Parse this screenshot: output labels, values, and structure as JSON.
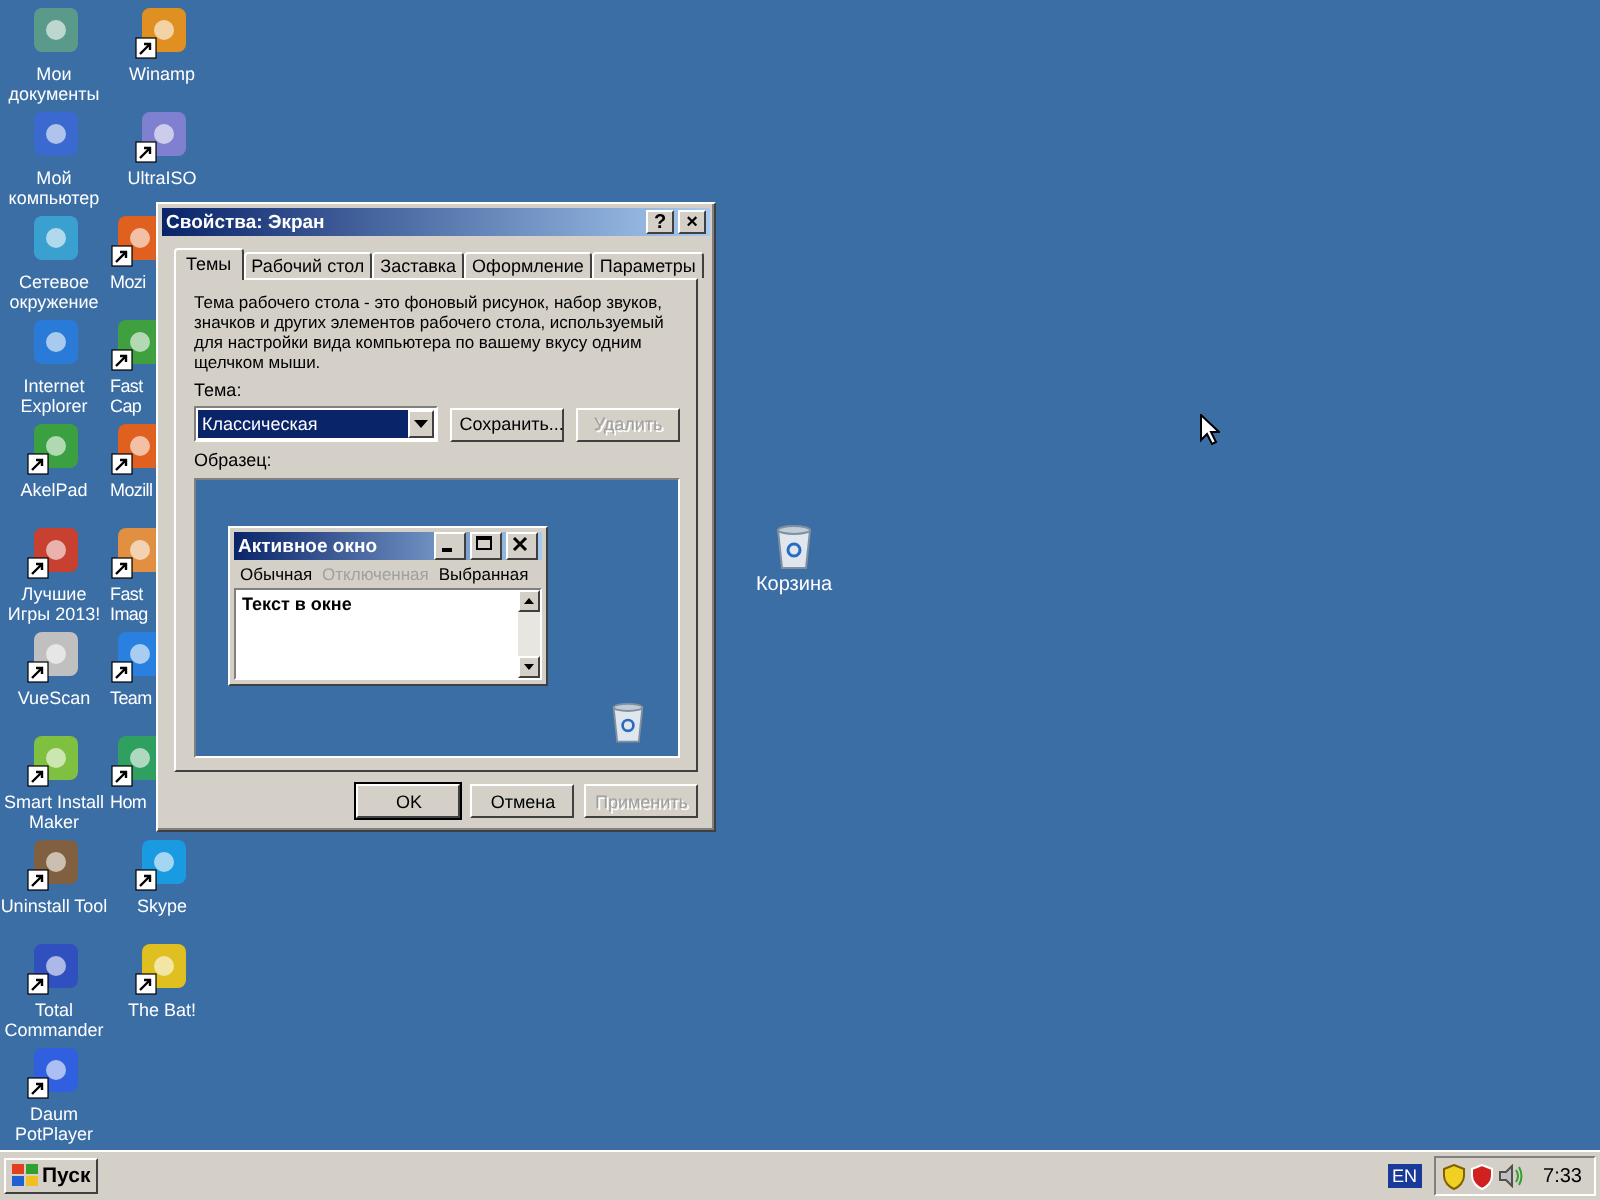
{
  "desktop_icons": [
    {
      "label": "Мои документы",
      "color": "#5a9a8a",
      "shortcut": false,
      "partial": false
    },
    {
      "label": "Мой компьютер",
      "color": "#3a6ad0",
      "shortcut": false,
      "partial": false
    },
    {
      "label": "Сетевое окружение",
      "color": "#3aa0d0",
      "shortcut": false,
      "partial": false
    },
    {
      "label": "Internet Explorer",
      "color": "#2a7ad8",
      "shortcut": false,
      "partial": false
    },
    {
      "label": "AkelPad",
      "color": "#3aa040",
      "shortcut": true,
      "partial": false
    },
    {
      "label": "Лучшие Игры 2013!",
      "color": "#c84030",
      "shortcut": true,
      "partial": false
    },
    {
      "label": "VueScan",
      "color": "#c0c0c0",
      "shortcut": true,
      "partial": false
    },
    {
      "label": "Smart Install Maker",
      "color": "#80c040",
      "shortcut": true,
      "partial": false
    },
    {
      "label": "Uninstall Tool",
      "color": "#806040",
      "shortcut": true,
      "partial": false
    },
    {
      "label": "Total Commander",
      "color": "#3050c0",
      "shortcut": true,
      "partial": false
    },
    {
      "label": "Daum PotPlayer",
      "color": "#3060e0",
      "shortcut": true,
      "partial": false
    },
    {
      "label": "Winamp",
      "color": "#e09020",
      "shortcut": true,
      "partial": false
    },
    {
      "label": "UltraISO",
      "color": "#8080d0",
      "shortcut": true,
      "partial": false
    },
    {
      "label": "Mozi",
      "color": "#e06020",
      "shortcut": true,
      "partial": true
    },
    {
      "label": "Fast Cap",
      "color": "#40a040",
      "shortcut": true,
      "partial": true
    },
    {
      "label": "Mozill",
      "color": "#e06020",
      "shortcut": true,
      "partial": true
    },
    {
      "label": "Fast Imag",
      "color": "#e09040",
      "shortcut": true,
      "partial": true
    },
    {
      "label": "Team",
      "color": "#2a80e0",
      "shortcut": true,
      "partial": true
    },
    {
      "label": "Hom",
      "color": "#30a060",
      "shortcut": true,
      "partial": true
    },
    {
      "label": "Skype",
      "color": "#1a9ae0",
      "shortcut": true,
      "partial": false
    },
    {
      "label": "The Bat!",
      "color": "#e0c020",
      "shortcut": true,
      "partial": false
    }
  ],
  "recycle_bin": {
    "label": "Корзина"
  },
  "dialog": {
    "title": "Свойства: Экран",
    "help": "?",
    "close": "×",
    "tabs": [
      {
        "label": "Темы",
        "selected": true
      },
      {
        "label": "Рабочий стол",
        "selected": false
      },
      {
        "label": "Заставка",
        "selected": false
      },
      {
        "label": "Оформление",
        "selected": false
      },
      {
        "label": "Параметры",
        "selected": false
      }
    ],
    "description": "Тема рабочего стола - это фоновый рисунок, набор звуков, значков и других элементов рабочего стола, используемый для настройки вида компьютера по вашему вкусу одним щелчком мыши.",
    "theme_label": "Тема:",
    "theme_value": "Классическая",
    "theme_buttons": [
      {
        "label": "Сохранить...",
        "disabled": false
      },
      {
        "label": "Удалить",
        "disabled": true
      }
    ],
    "sample_label": "Образец:",
    "sample_window": {
      "title": "Активное окно",
      "menu": [
        {
          "label": "Обычная",
          "disabled": false
        },
        {
          "label": "Отключенная",
          "disabled": true
        },
        {
          "label": "Выбранная",
          "disabled": false
        }
      ],
      "text": "Текст в окне"
    },
    "buttons": [
      {
        "label": "OK",
        "disabled": false,
        "default": true
      },
      {
        "label": "Отмена",
        "disabled": false,
        "default": false
      },
      {
        "label": "Применить",
        "disabled": true,
        "default": false
      }
    ]
  },
  "taskbar": {
    "start": "Пуск",
    "language": "EN",
    "clock": "7:33"
  }
}
